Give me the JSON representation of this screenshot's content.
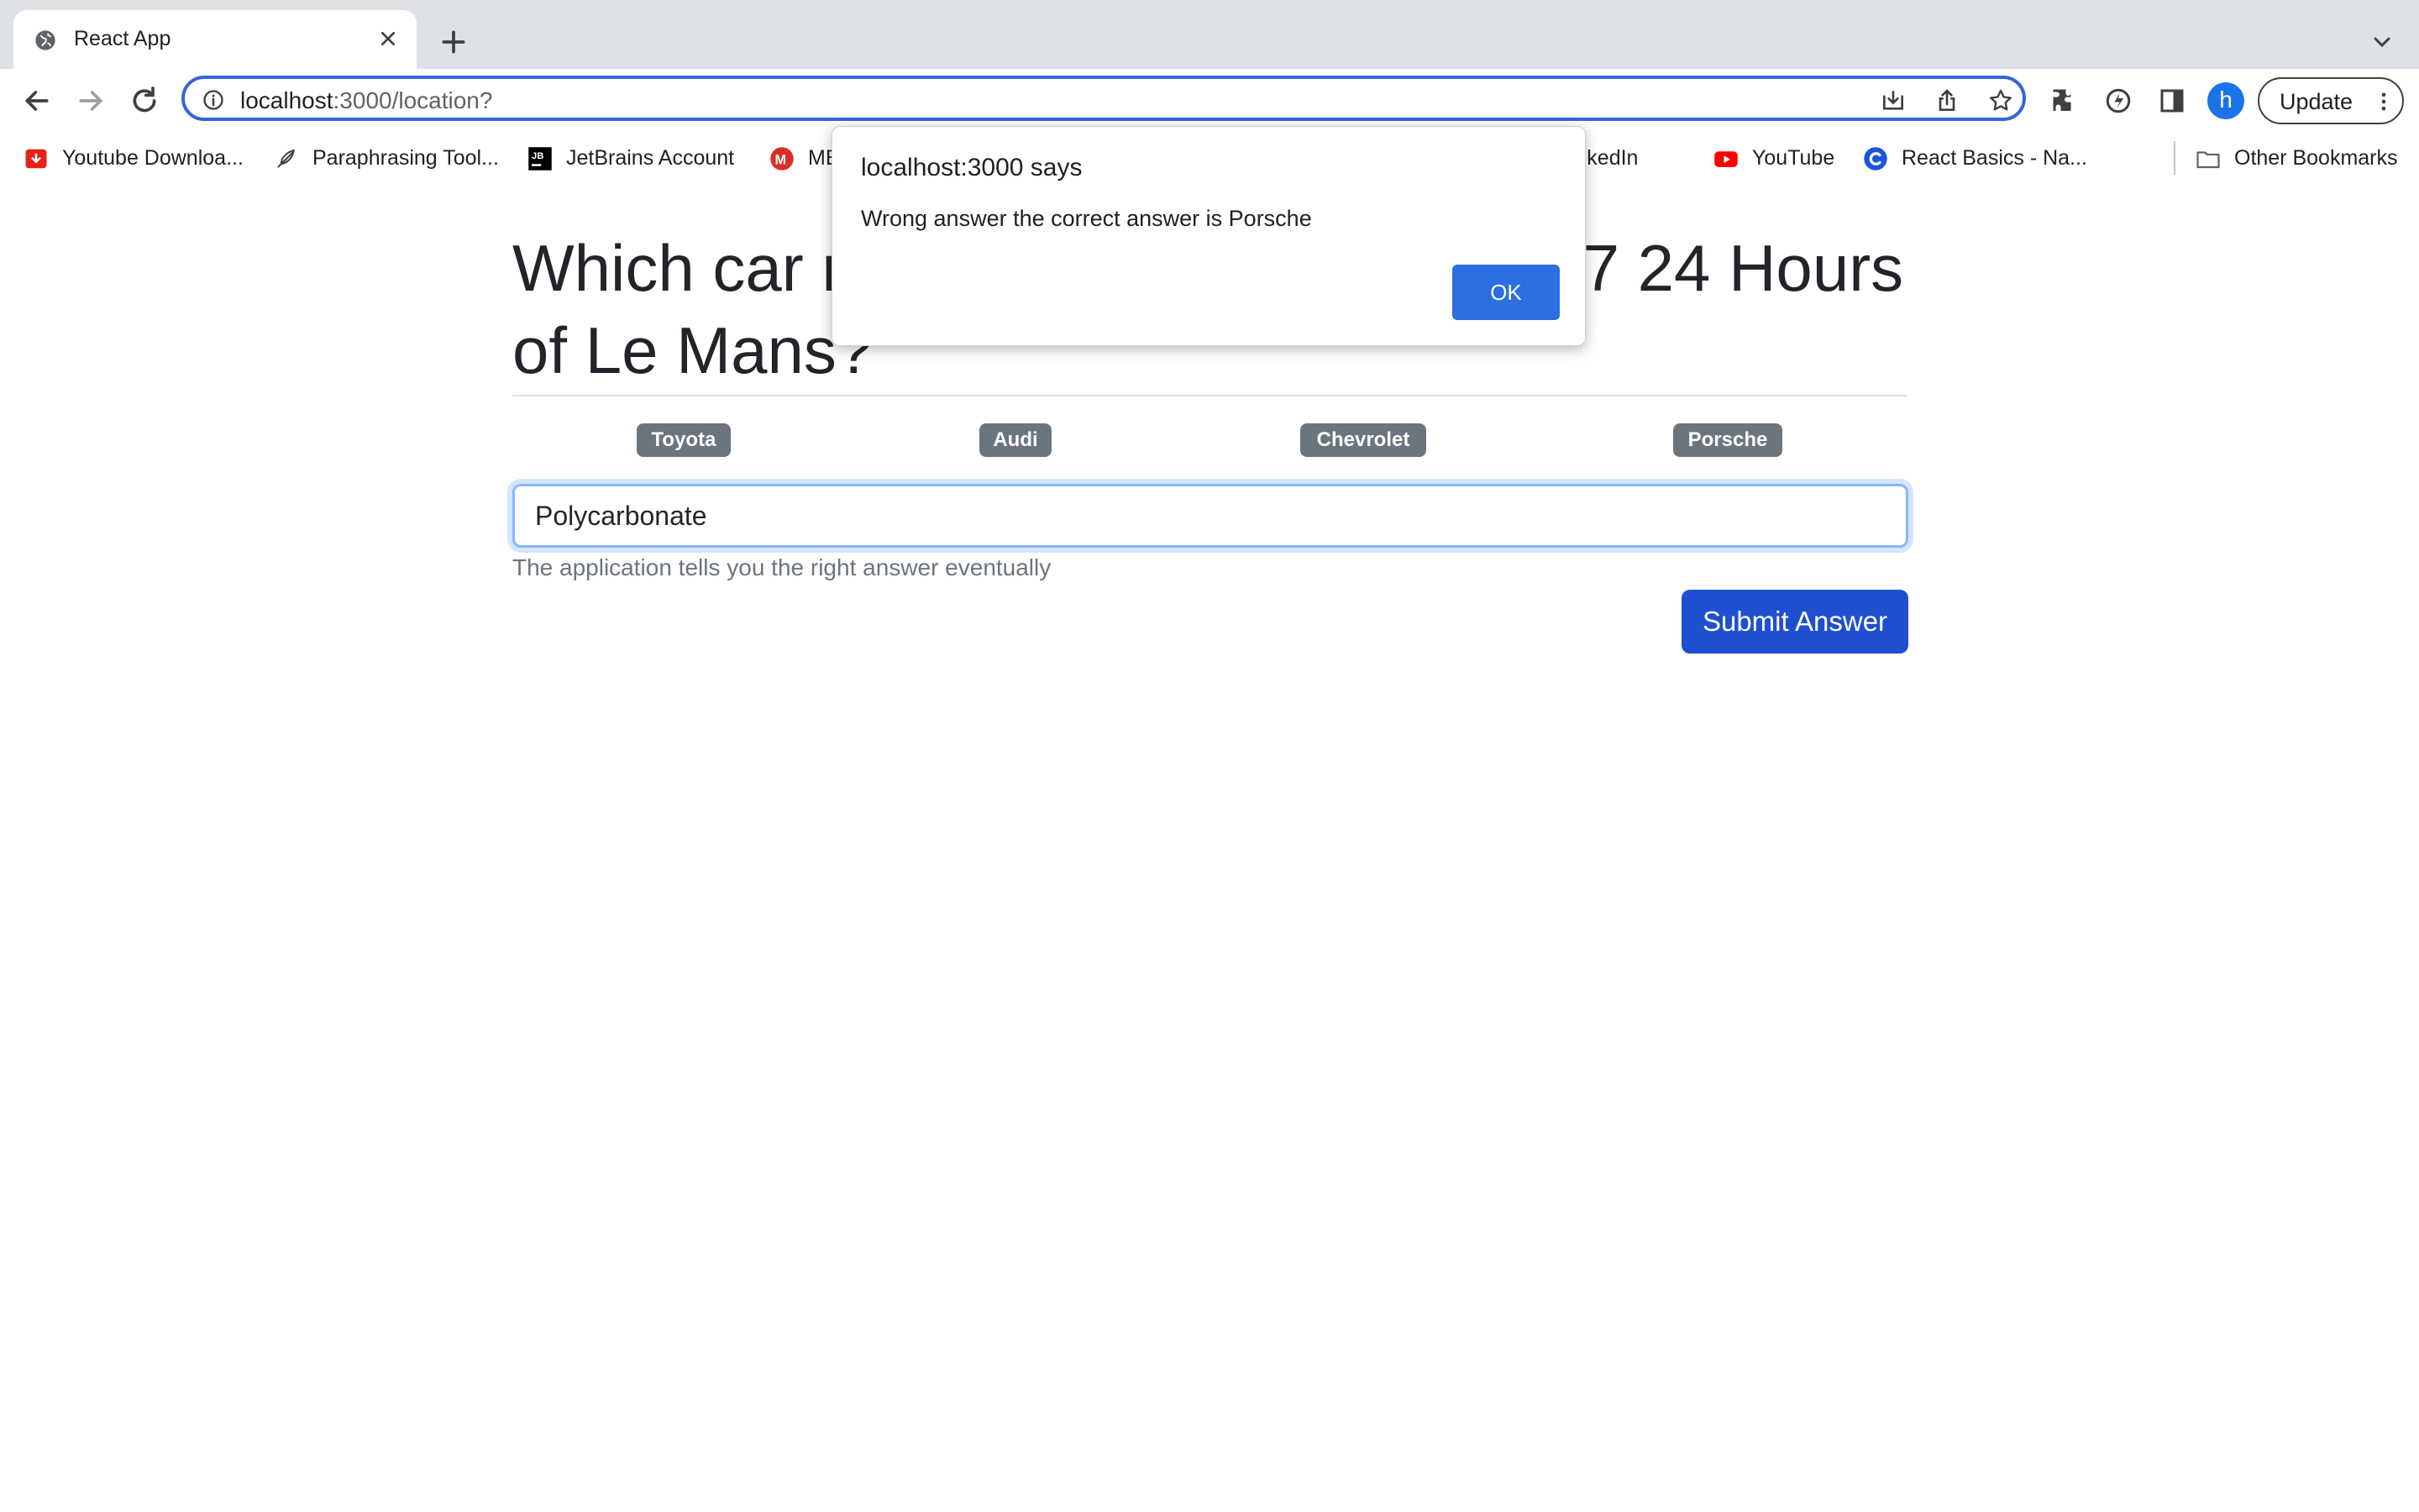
{
  "browser": {
    "tab": {
      "title": "React App"
    },
    "url": {
      "host": "localhost",
      "rest": ":3000/location?"
    },
    "avatar_letter": "h",
    "update_label": "Update",
    "bookmarks": [
      {
        "label": "Youtube Downloa...",
        "icon": "youtube-downloader-icon"
      },
      {
        "label": "Paraphrasing Tool...",
        "icon": "feather-icon"
      },
      {
        "label": "JetBrains Account",
        "icon": "jetbrains-icon"
      },
      {
        "label": "ME",
        "icon": "m-icon"
      },
      {
        "label": "l | LinkedIn",
        "icon": "linkedin"
      },
      {
        "label": "YouTube",
        "icon": "youtube-icon"
      },
      {
        "label": "React Basics - Na...",
        "icon": "c-icon"
      }
    ],
    "other_bookmarks": "Other Bookmarks"
  },
  "page": {
    "question": "Which car manufacturer won the 2017 24 Hours of Le Mans?",
    "options": [
      "Toyota",
      "Audi",
      "Chevrolet",
      "Porsche"
    ],
    "answer_value": "Polycarbonate",
    "helper_text": "The application tells you the right answer eventually",
    "submit_label": "Submit Answer"
  },
  "dialog": {
    "title": "localhost:3000 says",
    "message": "Wrong answer the correct answer is Porsche",
    "ok_label": "OK"
  },
  "colors": {
    "primary_button": "#1f4fd1",
    "badge": "#6c757d",
    "focus_ring": "#86b7fe",
    "dialog_ok": "#2b6fe0"
  }
}
